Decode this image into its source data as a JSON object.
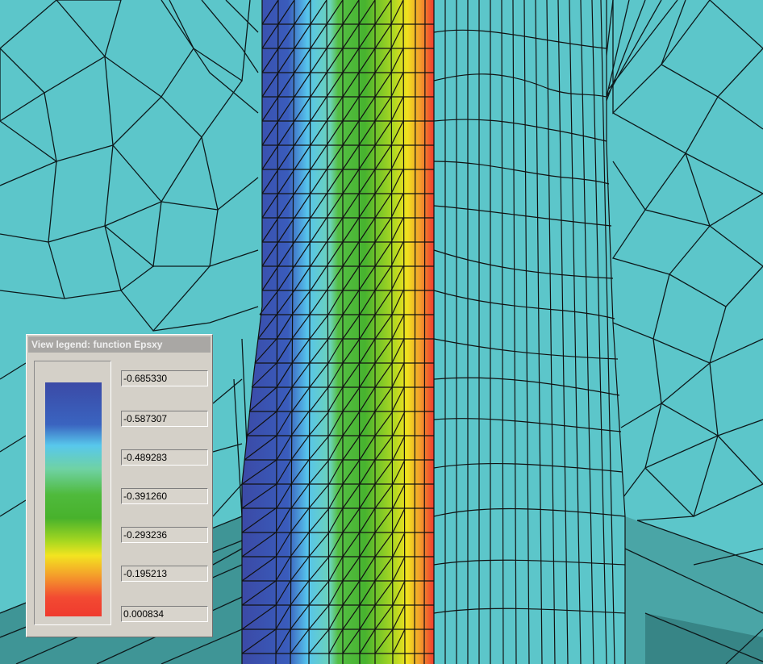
{
  "legend": {
    "title": "View legend: function Epsxy",
    "values": [
      "-0.685330",
      "-0.587307",
      "-0.489283",
      "-0.391260",
      "-0.293236",
      "-0.195213",
      "0.000834"
    ]
  },
  "colors": {
    "background": "#5cc6ca",
    "base": "#3f9596",
    "colormap": [
      "#3b4aa6",
      "#58c8ec",
      "#4fba3c",
      "#f3e420",
      "#f03a2e"
    ]
  }
}
